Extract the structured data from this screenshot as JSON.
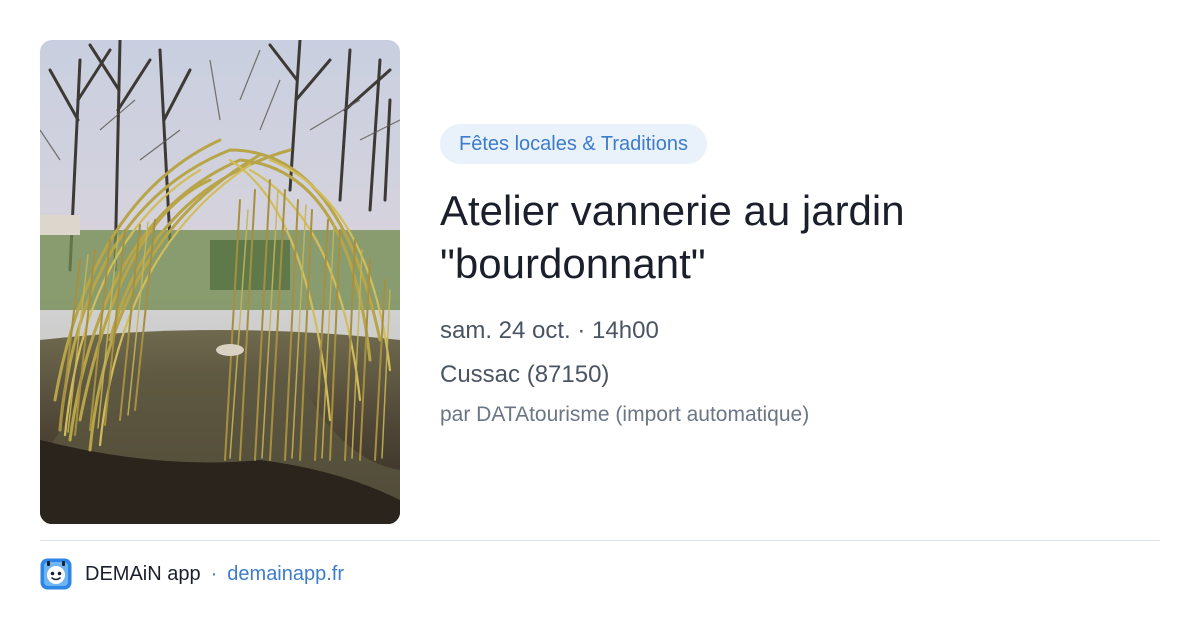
{
  "event": {
    "category": "Fêtes locales & Traditions",
    "title_line1": "Atelier vannerie au jardin",
    "title_line2": "\"bourdonnant\"",
    "date": "sam. 24 oct. · 14h00",
    "location": "Cussac (87150)",
    "source": "par DATAtourisme (import automatique)"
  },
  "footer": {
    "app_name": "DEMAiN app",
    "separator": "·",
    "domain": "demainapp.fr",
    "app_icon": "demain-app-logo-icon"
  },
  "colors": {
    "accent": "#3d7cc9",
    "tag_background": "#e9f2fb",
    "title": "#1a1f2b",
    "body_text": "#4a5463",
    "muted_text": "#6b7685",
    "divider": "#dde3ea"
  }
}
